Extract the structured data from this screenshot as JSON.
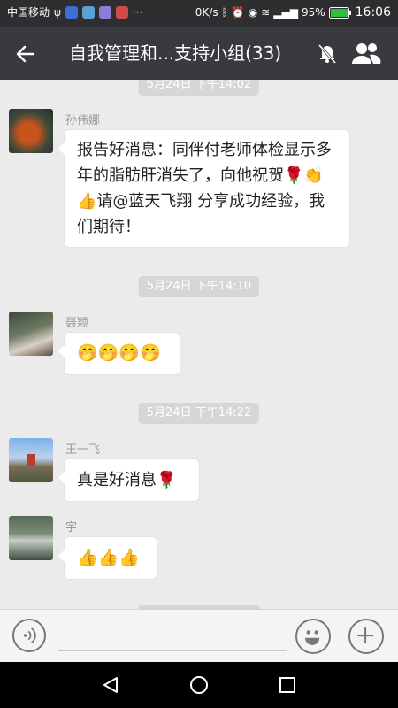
{
  "status_bar": {
    "carrier": "中国移动",
    "speed": "0K/s",
    "battery": "95%",
    "time": "16:06"
  },
  "header": {
    "title": "自我管理和...支持小组(33)",
    "icons": [
      "back-arrow-icon",
      "mute-bell-icon",
      "group-members-icon"
    ]
  },
  "chat": {
    "partial_timestamp": "5月24日 下午14:02",
    "messages": [
      {
        "sender": "孙伟娜",
        "text": "报告好消息：同伴付老师体检显示多年的脂肪肝消失了，向他祝贺🌹👏👍请@蓝天飞翔  分享成功经验，我们期待！"
      },
      {
        "timestamp": "5月24日 下午14:10",
        "sender": "聂颖",
        "text": "🤭🤭🤭🤭"
      },
      {
        "timestamp": "5月24日 下午14:22",
        "sender": "王一飞",
        "text": "真是好消息🌹"
      },
      {
        "sender": "宇",
        "text": "👍👍👍"
      }
    ]
  },
  "input_bar": {
    "icons": [
      "voice-icon",
      "emoji-icon",
      "plus-icon"
    ]
  },
  "nav_bar": {
    "icons": [
      "back-triangle-icon",
      "home-circle-icon",
      "recent-square-icon"
    ]
  }
}
